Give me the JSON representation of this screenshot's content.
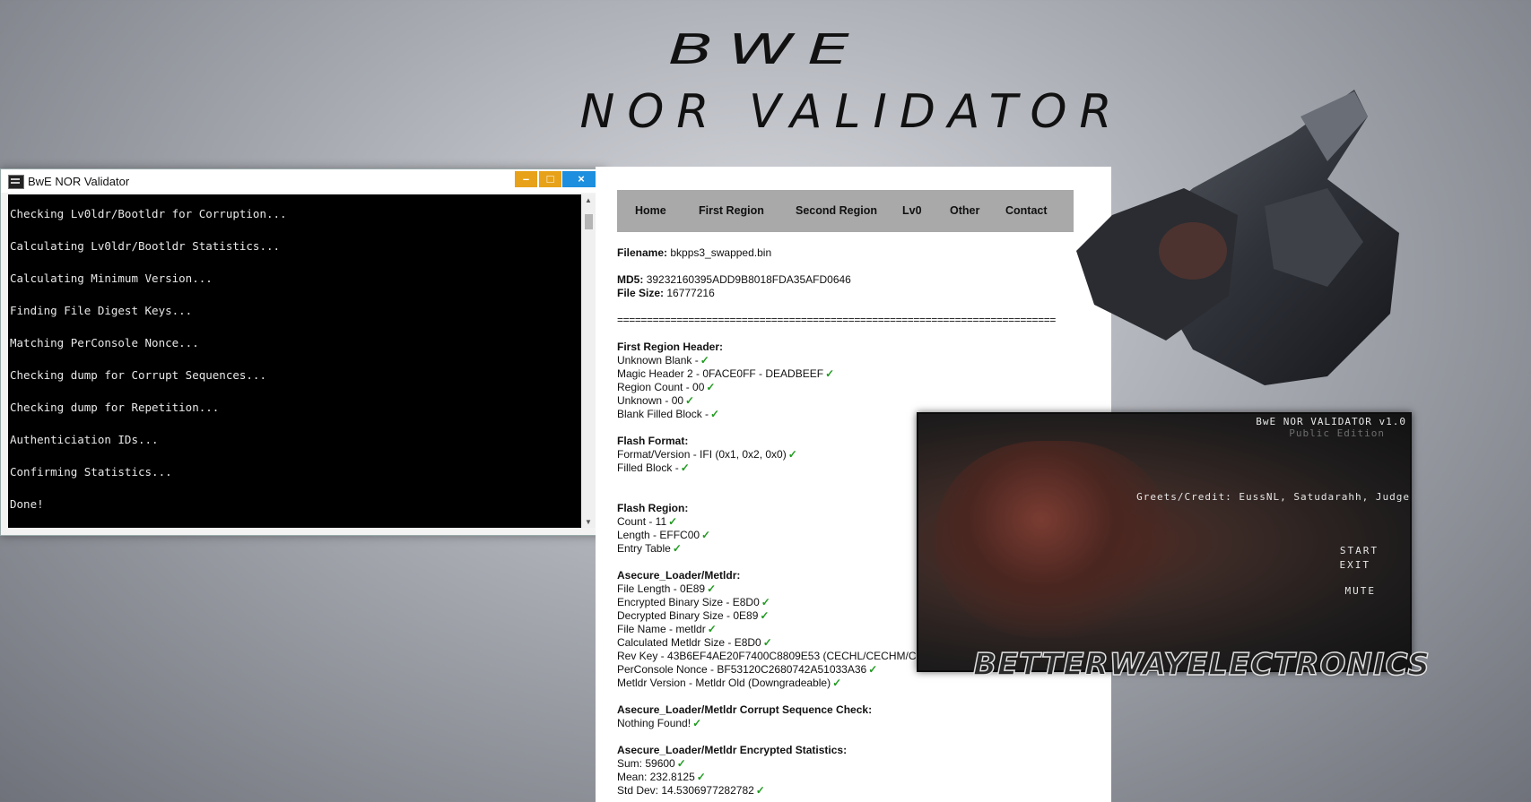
{
  "header": {
    "title_line1": "BWE",
    "title_line2": "NOR VALIDATOR"
  },
  "console": {
    "window_title": "BwE NOR Validator",
    "buttons": {
      "minimize": "–",
      "maximize": "□",
      "close": "×"
    },
    "lines": [
      "Checking Lv0ldr/Bootldr for Corruption...",
      "Calculating Lv0ldr/Bootldr Statistics...",
      "Calculating Minimum Version...",
      "Finding File Digest Keys...",
      "Matching PerConsole Nonce...",
      "Checking dump for Corrupt Sequences...",
      "Checking dump for Repetition...",
      "Authenticiation IDs...",
      "Confirming Statistics...",
      "Done!"
    ],
    "scroll_up": "▲",
    "scroll_down": "▼"
  },
  "nav": {
    "items": [
      "Home",
      "First Region",
      "Second Region",
      "Lv0",
      "Other",
      "Contact"
    ]
  },
  "report": {
    "filename_label": "Filename:",
    "filename": "bkpps3_swapped.bin",
    "md5_label": "MD5:",
    "md5": "39232160395ADD9B8018FDA35AFD0646",
    "filesize_label": "File Size:",
    "filesize": "16777216",
    "separator": "==========================================================================",
    "check_mark": "✓",
    "first_region_header": "First Region Header:",
    "first_region": [
      "Unknown Blank -",
      "Magic Header 2 - 0FACE0FF - DEADBEEF",
      "Region Count - 00",
      "Unknown - 00",
      "Blank Filled Block -"
    ],
    "flash_format_header": "Flash Format:",
    "flash_format": [
      "Format/Version - IFI (0x1, 0x2, 0x0)",
      "Filled Block -"
    ],
    "flash_region_header": "Flash Region:",
    "flash_region": [
      "Count - 11",
      "Length - EFFC00",
      "Entry Table"
    ],
    "metldr_header": "Asecure_Loader/Metldr:",
    "metldr": [
      "File Length - 0E89",
      "Encrypted Binary Size - E8D0",
      "Decrypted Binary Size - 0E89",
      "File Name - metldr",
      "Calculated Metldr Size - E8D0",
      "Rev Key - 43B6EF4AE20F7400C8809E53 (CECHL/CECHM/C",
      "PerConsole Nonce - BF53120C2680742A51033A36",
      "Metldr Version - Metldr Old (Downgradeable)"
    ],
    "corrupt_header": "Asecure_Loader/Metldr Corrupt Sequence Check:",
    "corrupt": [
      "Nothing Found!"
    ],
    "stats_header": "Asecure_Loader/Metldr Encrypted Statistics:",
    "stats": [
      "Sum: 59600",
      "Mean: 232.8125",
      "Std Dev: 14.5306977282782"
    ]
  },
  "splash": {
    "title": "BwE NOR VALIDATOR v1.0",
    "edition": "Public Edition",
    "greets": "Greets/Credit: EussNL, Satudarahh, Judge",
    "menu": [
      "START",
      "EXIT",
      "MUTE"
    ],
    "brand": "BETTERWAYELECTRONICS"
  }
}
